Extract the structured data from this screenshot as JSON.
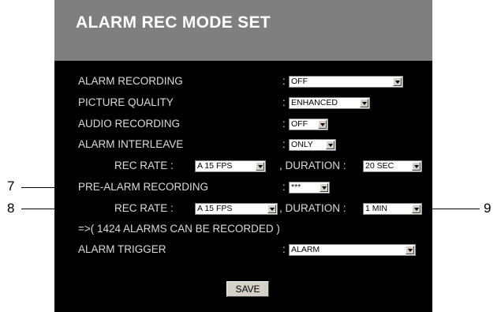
{
  "title": "ALARM REC MODE SET",
  "rows": {
    "alarm_recording": {
      "label": "ALARM RECORDING",
      "value": "OFF"
    },
    "picture_quality": {
      "label": "PICTURE QUALITY",
      "value": "ENHANCED"
    },
    "audio_recording": {
      "label": "AUDIO RECORDING",
      "value": "OFF"
    },
    "alarm_interleave": {
      "label": "ALARM INTERLEAVE",
      "value": "ONLY"
    },
    "rec_rate_1": {
      "label": "REC RATE :",
      "value": "A 15 FPS",
      "duration_label": ", DURATION :",
      "duration_value": "20 SEC"
    },
    "pre_alarm": {
      "label": "PRE-ALARM RECORDING",
      "value": "***"
    },
    "rec_rate_2": {
      "label": "REC RATE :",
      "value": "A 15 FPS",
      "duration_label": ", DURATION :",
      "duration_value": "1 MIN"
    },
    "alarms_note": "=>( 1424 ALARMS CAN BE RECORDED )",
    "alarm_trigger": {
      "label": "ALARM TRIGGER",
      "value": "ALARM"
    }
  },
  "colon": ":",
  "save_label": "SAVE",
  "callouts": {
    "c7": "7",
    "c8": "8",
    "c9": "9"
  },
  "colors": {
    "panel": "#000000",
    "header": "#7f7f7f",
    "text": "#dcdcdc"
  }
}
